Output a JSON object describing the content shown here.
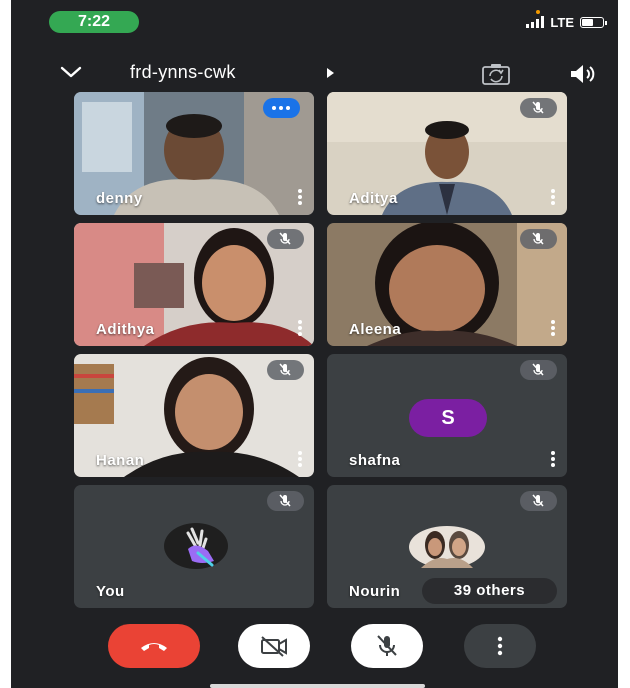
{
  "status_bar": {
    "time": "7:22",
    "network": "LTE",
    "battery_level": 0.6
  },
  "header": {
    "meeting_code": "frd-ynns-cwk",
    "icons": [
      "chevron-down-icon",
      "play-arrow-icon",
      "camera-switch-icon",
      "speaker-icon"
    ]
  },
  "participants": [
    {
      "name": "denny",
      "muted": false,
      "badge": "more-options"
    },
    {
      "name": "Aditya",
      "muted": true
    },
    {
      "name": "Adithya",
      "muted": true
    },
    {
      "name": "Aleena",
      "muted": true
    },
    {
      "name": "Hanan",
      "muted": true
    },
    {
      "name": "shafna",
      "muted": true,
      "avatar_letter": "S",
      "avatar_color": "#7b1fa2"
    },
    {
      "name": "You",
      "muted": true
    },
    {
      "name": "Nourin",
      "muted": true
    }
  ],
  "others_label": "39 others",
  "controls": {
    "end_call_color": "#ea4335",
    "buttons": [
      "end-call",
      "camera-off",
      "mic-off",
      "more-options"
    ]
  },
  "colors": {
    "background": "#202124",
    "tile": "#3c4043",
    "accent_blue": "#1a73e8",
    "time_pill": "#34a853"
  }
}
